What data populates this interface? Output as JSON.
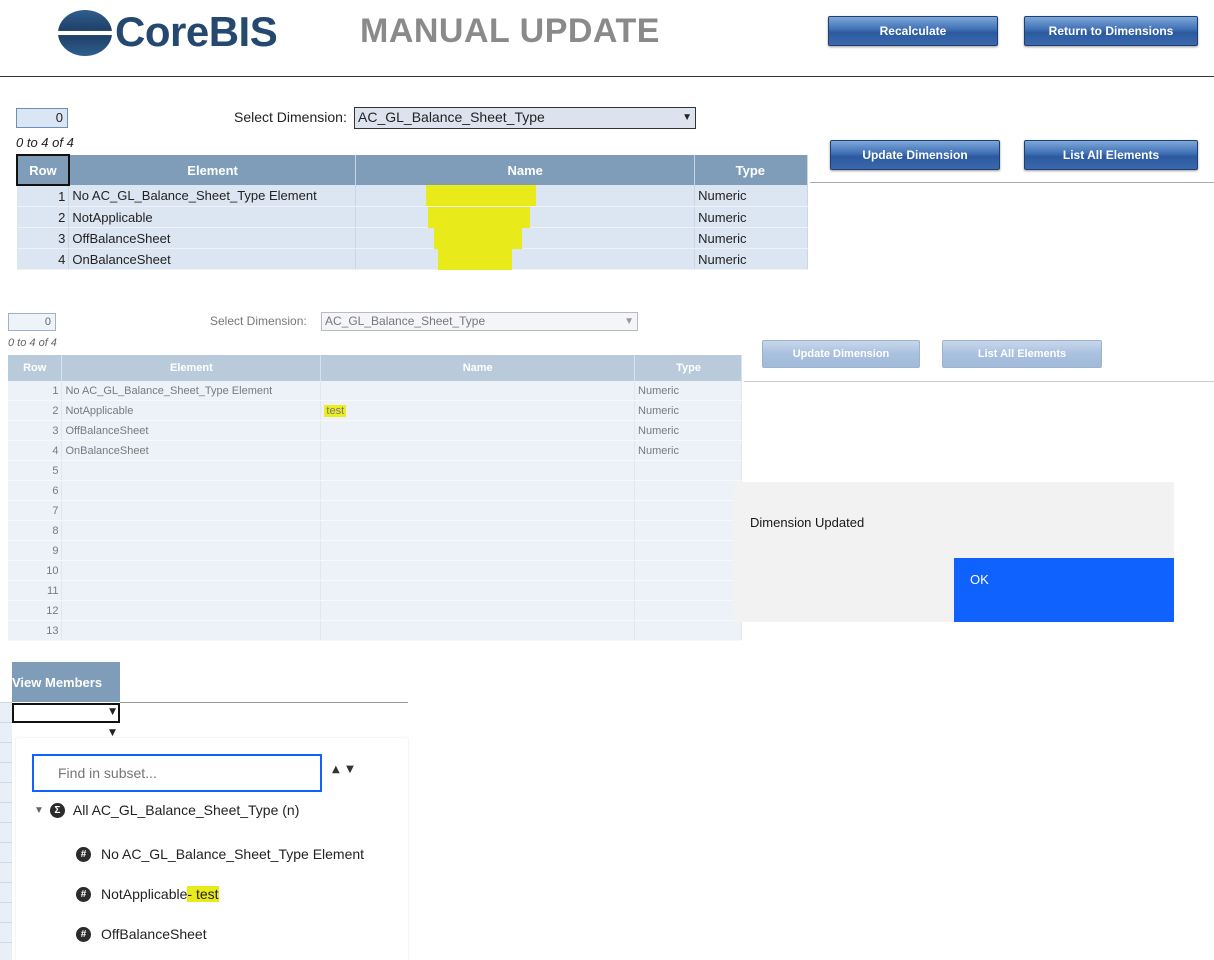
{
  "header": {
    "logo_text": "CoreBIS",
    "page_title": "MANUAL UPDATE",
    "recalculate_label": "Recalculate",
    "return_label": "Return to Dimensions"
  },
  "section1": {
    "counter": "0",
    "select_label": "Select Dimension:",
    "select_value": "AC_GL_Balance_Sheet_Type",
    "pager": "0 to 4 of 4",
    "update_label": "Update Dimension",
    "list_label": "List All Elements",
    "columns": [
      "Row",
      "Element",
      "Name",
      "Type"
    ],
    "rows": [
      {
        "row": "1",
        "element": "No AC_GL_Balance_Sheet_Type Element",
        "name": "",
        "type": "Numeric"
      },
      {
        "row": "2",
        "element": "NotApplicable",
        "name": "",
        "type": "Numeric"
      },
      {
        "row": "3",
        "element": "OffBalanceSheet",
        "name": "",
        "type": "Numeric"
      },
      {
        "row": "4",
        "element": "OnBalanceSheet",
        "name": "",
        "type": "Numeric"
      }
    ]
  },
  "section2": {
    "counter": "0",
    "select_label": "Select Dimension:",
    "select_value": "AC_GL_Balance_Sheet_Type",
    "pager": "0 to 4 of 4",
    "update_label": "Update Dimension",
    "list_label": "List All Elements",
    "columns": [
      "Row",
      "Element",
      "Name",
      "Type"
    ],
    "rows": [
      {
        "row": "1",
        "element": "No AC_GL_Balance_Sheet_Type Element",
        "name": "",
        "type": "Numeric"
      },
      {
        "row": "2",
        "element": "NotApplicable",
        "name": "test",
        "type": "Numeric"
      },
      {
        "row": "3",
        "element": "OffBalanceSheet",
        "name": "",
        "type": "Numeric"
      },
      {
        "row": "4",
        "element": "OnBalanceSheet",
        "name": "",
        "type": "Numeric"
      },
      {
        "row": "5",
        "element": "",
        "name": "",
        "type": ""
      },
      {
        "row": "6",
        "element": "",
        "name": "",
        "type": ""
      },
      {
        "row": "7",
        "element": "",
        "name": "",
        "type": ""
      },
      {
        "row": "8",
        "element": "",
        "name": "",
        "type": ""
      },
      {
        "row": "9",
        "element": "",
        "name": "",
        "type": ""
      },
      {
        "row": "10",
        "element": "",
        "name": "",
        "type": ""
      },
      {
        "row": "11",
        "element": "",
        "name": "",
        "type": ""
      },
      {
        "row": "12",
        "element": "",
        "name": "",
        "type": ""
      },
      {
        "row": "13",
        "element": "",
        "name": "",
        "type": ""
      }
    ]
  },
  "dialog": {
    "message": "Dimension Updated",
    "ok_label": "OK"
  },
  "members": {
    "header": "View Members",
    "search_placeholder": "Find in subset...",
    "root": "All AC_GL_Balance_Sheet_Type (n)",
    "items": [
      {
        "label": "No AC_GL_Balance_Sheet_Type Element",
        "suffix": ""
      },
      {
        "label": "NotApplicable",
        "suffix": " - test"
      },
      {
        "label": "OffBalanceSheet",
        "suffix": ""
      }
    ]
  },
  "colors": {
    "brand": "#24486f",
    "header_blue": "#7f9db8",
    "highlight": "#e8ea1a",
    "ok_button": "#0f62fe"
  }
}
